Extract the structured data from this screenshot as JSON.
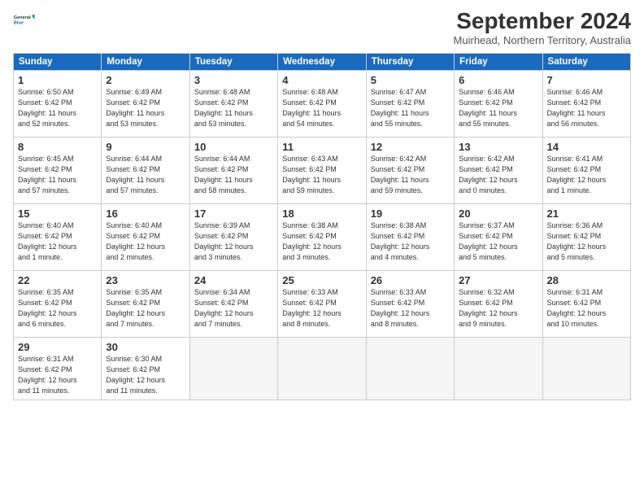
{
  "header": {
    "logo_line1": "General",
    "logo_line2": "Blue",
    "month_title": "September 2024",
    "location": "Muirhead, Northern Territory, Australia"
  },
  "weekdays": [
    "Sunday",
    "Monday",
    "Tuesday",
    "Wednesday",
    "Thursday",
    "Friday",
    "Saturday"
  ],
  "weeks": [
    [
      {
        "day": "1",
        "info": "Sunrise: 6:50 AM\nSunset: 6:42 PM\nDaylight: 11 hours\nand 52 minutes."
      },
      {
        "day": "2",
        "info": "Sunrise: 6:49 AM\nSunset: 6:42 PM\nDaylight: 11 hours\nand 53 minutes."
      },
      {
        "day": "3",
        "info": "Sunrise: 6:48 AM\nSunset: 6:42 PM\nDaylight: 11 hours\nand 53 minutes."
      },
      {
        "day": "4",
        "info": "Sunrise: 6:48 AM\nSunset: 6:42 PM\nDaylight: 11 hours\nand 54 minutes."
      },
      {
        "day": "5",
        "info": "Sunrise: 6:47 AM\nSunset: 6:42 PM\nDaylight: 11 hours\nand 55 minutes."
      },
      {
        "day": "6",
        "info": "Sunrise: 6:46 AM\nSunset: 6:42 PM\nDaylight: 11 hours\nand 55 minutes."
      },
      {
        "day": "7",
        "info": "Sunrise: 6:46 AM\nSunset: 6:42 PM\nDaylight: 11 hours\nand 56 minutes."
      }
    ],
    [
      {
        "day": "8",
        "info": "Sunrise: 6:45 AM\nSunset: 6:42 PM\nDaylight: 11 hours\nand 57 minutes."
      },
      {
        "day": "9",
        "info": "Sunrise: 6:44 AM\nSunset: 6:42 PM\nDaylight: 11 hours\nand 57 minutes."
      },
      {
        "day": "10",
        "info": "Sunrise: 6:44 AM\nSunset: 6:42 PM\nDaylight: 11 hours\nand 58 minutes."
      },
      {
        "day": "11",
        "info": "Sunrise: 6:43 AM\nSunset: 6:42 PM\nDaylight: 11 hours\nand 59 minutes."
      },
      {
        "day": "12",
        "info": "Sunrise: 6:42 AM\nSunset: 6:42 PM\nDaylight: 11 hours\nand 59 minutes."
      },
      {
        "day": "13",
        "info": "Sunrise: 6:42 AM\nSunset: 6:42 PM\nDaylight: 12 hours\nand 0 minutes."
      },
      {
        "day": "14",
        "info": "Sunrise: 6:41 AM\nSunset: 6:42 PM\nDaylight: 12 hours\nand 1 minute."
      }
    ],
    [
      {
        "day": "15",
        "info": "Sunrise: 6:40 AM\nSunset: 6:42 PM\nDaylight: 12 hours\nand 1 minute."
      },
      {
        "day": "16",
        "info": "Sunrise: 6:40 AM\nSunset: 6:42 PM\nDaylight: 12 hours\nand 2 minutes."
      },
      {
        "day": "17",
        "info": "Sunrise: 6:39 AM\nSunset: 6:42 PM\nDaylight: 12 hours\nand 3 minutes."
      },
      {
        "day": "18",
        "info": "Sunrise: 6:38 AM\nSunset: 6:42 PM\nDaylight: 12 hours\nand 3 minutes."
      },
      {
        "day": "19",
        "info": "Sunrise: 6:38 AM\nSunset: 6:42 PM\nDaylight: 12 hours\nand 4 minutes."
      },
      {
        "day": "20",
        "info": "Sunrise: 6:37 AM\nSunset: 6:42 PM\nDaylight: 12 hours\nand 5 minutes."
      },
      {
        "day": "21",
        "info": "Sunrise: 6:36 AM\nSunset: 6:42 PM\nDaylight: 12 hours\nand 5 minutes."
      }
    ],
    [
      {
        "day": "22",
        "info": "Sunrise: 6:35 AM\nSunset: 6:42 PM\nDaylight: 12 hours\nand 6 minutes."
      },
      {
        "day": "23",
        "info": "Sunrise: 6:35 AM\nSunset: 6:42 PM\nDaylight: 12 hours\nand 7 minutes."
      },
      {
        "day": "24",
        "info": "Sunrise: 6:34 AM\nSunset: 6:42 PM\nDaylight: 12 hours\nand 7 minutes."
      },
      {
        "day": "25",
        "info": "Sunrise: 6:33 AM\nSunset: 6:42 PM\nDaylight: 12 hours\nand 8 minutes."
      },
      {
        "day": "26",
        "info": "Sunrise: 6:33 AM\nSunset: 6:42 PM\nDaylight: 12 hours\nand 8 minutes."
      },
      {
        "day": "27",
        "info": "Sunrise: 6:32 AM\nSunset: 6:42 PM\nDaylight: 12 hours\nand 9 minutes."
      },
      {
        "day": "28",
        "info": "Sunrise: 6:31 AM\nSunset: 6:42 PM\nDaylight: 12 hours\nand 10 minutes."
      }
    ],
    [
      {
        "day": "29",
        "info": "Sunrise: 6:31 AM\nSunset: 6:42 PM\nDaylight: 12 hours\nand 11 minutes."
      },
      {
        "day": "30",
        "info": "Sunrise: 6:30 AM\nSunset: 6:42 PM\nDaylight: 12 hours\nand 11 minutes."
      },
      {
        "day": "",
        "info": ""
      },
      {
        "day": "",
        "info": ""
      },
      {
        "day": "",
        "info": ""
      },
      {
        "day": "",
        "info": ""
      },
      {
        "day": "",
        "info": ""
      }
    ]
  ]
}
